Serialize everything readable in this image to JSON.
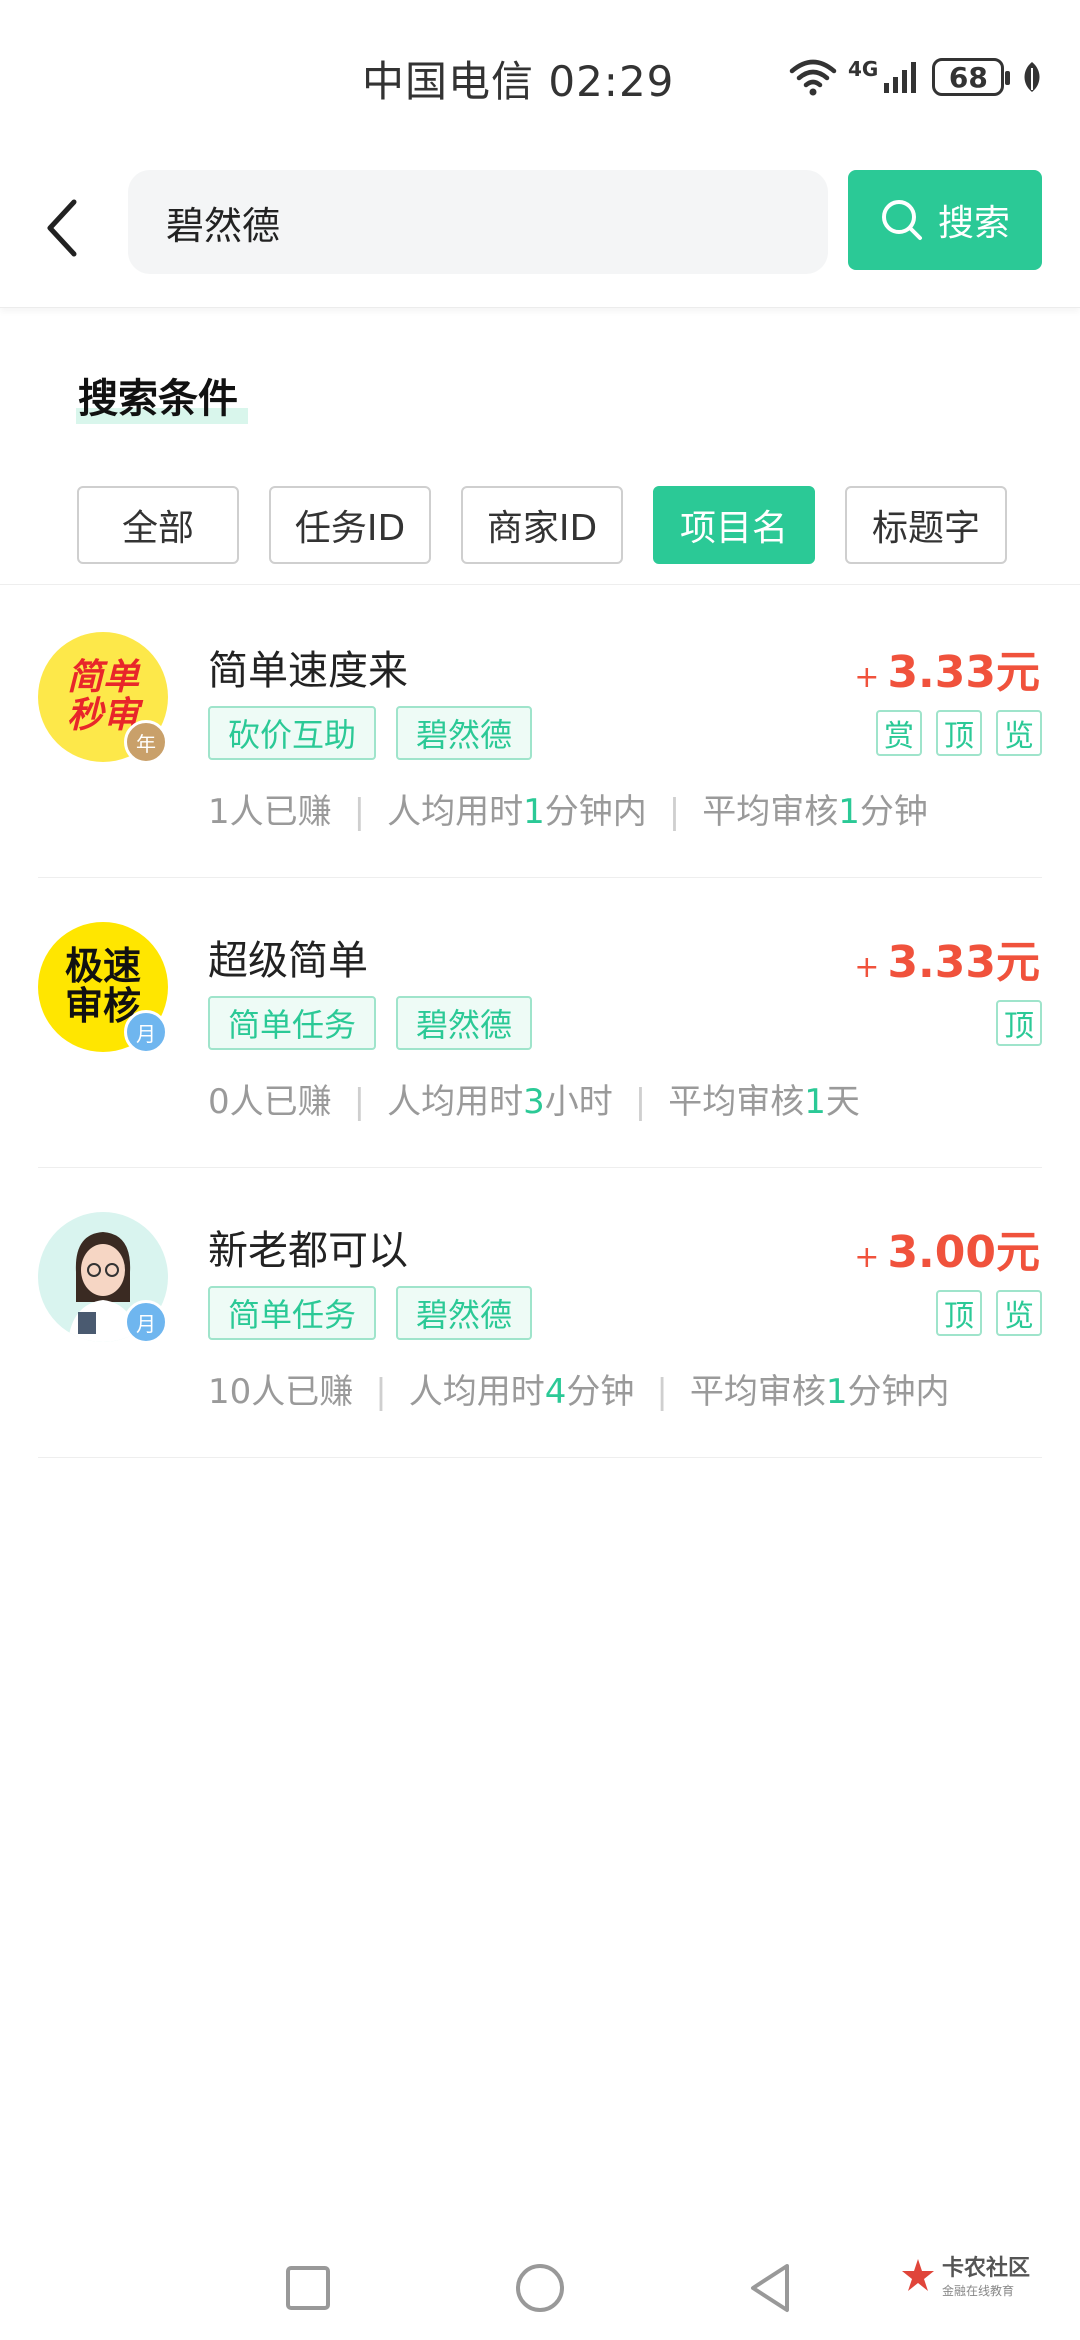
{
  "status_bar": {
    "carrier_time": "中国电信 02:29",
    "network": "4G",
    "battery": "68"
  },
  "search": {
    "value": "碧然德",
    "button_label": "搜索"
  },
  "conditions": {
    "title": "搜索条件",
    "filters": [
      {
        "label": "全部",
        "active": false
      },
      {
        "label": "任务ID",
        "active": false
      },
      {
        "label": "商家ID",
        "active": false
      },
      {
        "label": "项目名",
        "active": true
      },
      {
        "label": "标题字",
        "active": false
      }
    ]
  },
  "tasks": [
    {
      "title": "简单速度来",
      "price_plus": "+",
      "price": "3.33元",
      "avatar_text": [
        "简单",
        "秒审"
      ],
      "avatar_badge": "年",
      "tags": [
        "砍价互助",
        "碧然德"
      ],
      "marks": [
        "赏",
        "顶",
        "览"
      ],
      "earned": "1人已赚",
      "time_prefix": "人均用时",
      "time_value": "1",
      "time_suffix": "分钟内",
      "review_prefix": "平均审核",
      "review_value": "1",
      "review_suffix": "分钟"
    },
    {
      "title": "超级简单",
      "price_plus": "+",
      "price": "3.33元",
      "avatar_text": [
        "极速",
        "审核"
      ],
      "avatar_badge": "月",
      "tags": [
        "简单任务",
        "碧然德"
      ],
      "marks": [
        "顶"
      ],
      "earned": "0人已赚",
      "time_prefix": "人均用时",
      "time_value": "3",
      "time_suffix": "小时",
      "review_prefix": "平均审核",
      "review_value": "1",
      "review_suffix": "天"
    },
    {
      "title": "新老都可以",
      "price_plus": "+",
      "price": "3.00元",
      "avatar_badge": "月",
      "tags": [
        "简单任务",
        "碧然德"
      ],
      "marks": [
        "顶",
        "览"
      ],
      "earned": "10人已赚",
      "time_prefix": "人均用时",
      "time_value": "4",
      "time_suffix": "分钟",
      "review_prefix": "平均审核",
      "review_value": "1",
      "review_suffix": "分钟内"
    }
  ],
  "watermark": {
    "main": "卡农社区",
    "sub": "金融在线教育"
  },
  "colors": {
    "accent": "#2bc996",
    "price": "#f0523c"
  }
}
